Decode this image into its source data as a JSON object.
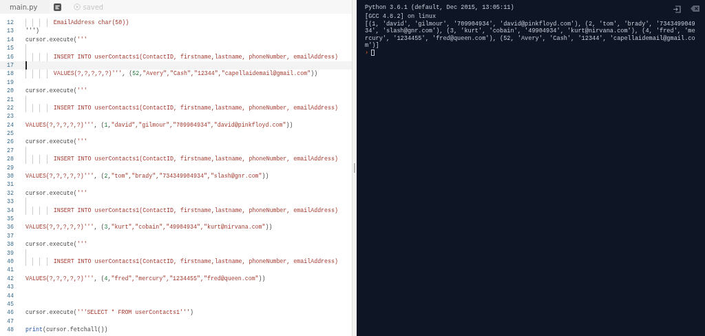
{
  "tabs": [
    {
      "label": "main.py",
      "selected": true
    }
  ],
  "save_status": {
    "label": "saved"
  },
  "editor": {
    "lines": [
      {
        "number": "12",
        "kind": "indented",
        "current": false,
        "segments": [
          {
            "text": "EmailAddress char(50))",
            "kind": "string"
          }
        ]
      },
      {
        "number": "13",
        "kind": "code",
        "current": false,
        "segments": [
          {
            "text": "''')",
            "kind": "plain"
          }
        ]
      },
      {
        "number": "14",
        "kind": "code",
        "current": false,
        "segments": [
          {
            "text": "cursor.execute(",
            "kind": "plain"
          },
          {
            "text": "'''",
            "kind": "string"
          }
        ]
      },
      {
        "number": "15",
        "kind": "guide",
        "current": false
      },
      {
        "number": "16",
        "kind": "indented",
        "current": false,
        "segments": [
          {
            "text": "INSERT INTO userContacts1(ContactID, firstname,lastname, phoneNumber, emailAddress)",
            "kind": "string"
          }
        ]
      },
      {
        "number": "17",
        "kind": "blank",
        "current": true
      },
      {
        "number": "18",
        "kind": "indented",
        "current": false,
        "segments": [
          {
            "text": "VALUES(?,?,?,?,?)'''",
            "kind": "string"
          },
          {
            "text": ", (",
            "kind": "plain"
          },
          {
            "text": "52",
            "kind": "number"
          },
          {
            "text": ",",
            "kind": "plain"
          },
          {
            "text": "\"Avery\",\"Cash\",\"12344\",\"capellaidemail@gmail.com\"",
            "kind": "string"
          },
          {
            "text": "))",
            "kind": "plain"
          }
        ]
      },
      {
        "number": "19",
        "kind": "blank",
        "current": false
      },
      {
        "number": "20",
        "kind": "code",
        "current": false,
        "segments": [
          {
            "text": "cursor.execute(",
            "kind": "plain"
          },
          {
            "text": "'''",
            "kind": "string"
          }
        ]
      },
      {
        "number": "21",
        "kind": "guide",
        "current": false
      },
      {
        "number": "22",
        "kind": "indented",
        "current": false,
        "segments": [
          {
            "text": "INSERT INTO userContacts1(ContactID, firstname,lastname, phoneNumber, emailAddress)",
            "kind": "string"
          }
        ]
      },
      {
        "number": "23",
        "kind": "blank",
        "current": false
      },
      {
        "number": "24",
        "kind": "code",
        "current": false,
        "segments": [
          {
            "text": "VALUES(?,?,?,?,?)'''",
            "kind": "string"
          },
          {
            "text": ", (",
            "kind": "plain"
          },
          {
            "text": "1",
            "kind": "number"
          },
          {
            "text": ",",
            "kind": "plain"
          },
          {
            "text": "\"david\",\"gilmour\",\"709904934\",\"david@pinkfloyd.com\"",
            "kind": "string"
          },
          {
            "text": "))",
            "kind": "plain"
          }
        ]
      },
      {
        "number": "25",
        "kind": "blank",
        "current": false
      },
      {
        "number": "26",
        "kind": "code",
        "current": false,
        "segments": [
          {
            "text": "cursor.execute(",
            "kind": "plain"
          },
          {
            "text": "'''",
            "kind": "string"
          }
        ]
      },
      {
        "number": "27",
        "kind": "guide",
        "current": false
      },
      {
        "number": "28",
        "kind": "indented",
        "current": false,
        "segments": [
          {
            "text": "INSERT INTO userContacts1(ContactID, firstname,lastname, phoneNumber, emailAddress)",
            "kind": "string"
          }
        ]
      },
      {
        "number": "29",
        "kind": "blank",
        "current": false
      },
      {
        "number": "30",
        "kind": "code",
        "current": false,
        "segments": [
          {
            "text": "VALUES(?,?,?,?,?)'''",
            "kind": "string"
          },
          {
            "text": ", (",
            "kind": "plain"
          },
          {
            "text": "2",
            "kind": "number"
          },
          {
            "text": ",",
            "kind": "plain"
          },
          {
            "text": "\"tom\",\"brady\",\"734349904934\",\"slash@gnr.com\"",
            "kind": "string"
          },
          {
            "text": "))",
            "kind": "plain"
          }
        ]
      },
      {
        "number": "31",
        "kind": "blank",
        "current": false
      },
      {
        "number": "32",
        "kind": "code",
        "current": false,
        "segments": [
          {
            "text": "cursor.execute(",
            "kind": "plain"
          },
          {
            "text": "'''",
            "kind": "string"
          }
        ]
      },
      {
        "number": "33",
        "kind": "guide",
        "current": false
      },
      {
        "number": "34",
        "kind": "indented",
        "current": false,
        "segments": [
          {
            "text": "INSERT INTO userContacts1(ContactID, firstname,lastname, phoneNumber, emailAddress)",
            "kind": "string"
          }
        ]
      },
      {
        "number": "35",
        "kind": "blank",
        "current": false
      },
      {
        "number": "36",
        "kind": "code",
        "current": false,
        "segments": [
          {
            "text": "VALUES(?,?,?,?,?)'''",
            "kind": "string"
          },
          {
            "text": ", (",
            "kind": "plain"
          },
          {
            "text": "3",
            "kind": "number"
          },
          {
            "text": ",",
            "kind": "plain"
          },
          {
            "text": "\"kurt\",\"cobain\",\"49904934\",\"kurt@nirvana.com\"",
            "kind": "string"
          },
          {
            "text": "))",
            "kind": "plain"
          }
        ]
      },
      {
        "number": "37",
        "kind": "blank",
        "current": false
      },
      {
        "number": "38",
        "kind": "code",
        "current": false,
        "segments": [
          {
            "text": "cursor.execute(",
            "kind": "plain"
          },
          {
            "text": "'''",
            "kind": "string"
          }
        ]
      },
      {
        "number": "39",
        "kind": "guide",
        "current": false
      },
      {
        "number": "40",
        "kind": "indented",
        "current": false,
        "segments": [
          {
            "text": "INSERT INTO userContacts1(ContactID, firstname,lastname, phoneNumber, emailAddress)",
            "kind": "string"
          }
        ]
      },
      {
        "number": "41",
        "kind": "blank",
        "current": false
      },
      {
        "number": "42",
        "kind": "code",
        "current": false,
        "segments": [
          {
            "text": "VALUES(?,?,?,?,?)'''",
            "kind": "string"
          },
          {
            "text": ", (",
            "kind": "plain"
          },
          {
            "text": "4",
            "kind": "number"
          },
          {
            "text": ",",
            "kind": "plain"
          },
          {
            "text": "\"fred\",\"mercury\",\"1234455\",\"fred@queen.com\"",
            "kind": "string"
          },
          {
            "text": "))",
            "kind": "plain"
          }
        ]
      },
      {
        "number": "43",
        "kind": "blank",
        "current": false
      },
      {
        "number": "44",
        "kind": "blank",
        "current": false
      },
      {
        "number": "45",
        "kind": "blank",
        "current": false
      },
      {
        "number": "46",
        "kind": "code",
        "current": false,
        "segments": [
          {
            "text": "cursor.execute(",
            "kind": "plain"
          },
          {
            "text": "'''SELECT * FROM userContacts1'''",
            "kind": "string"
          },
          {
            "text": ")",
            "kind": "plain"
          }
        ]
      },
      {
        "number": "47",
        "kind": "blank",
        "current": false
      },
      {
        "number": "48",
        "kind": "code",
        "current": false,
        "segments": [
          {
            "text": "print",
            "kind": "builtin"
          },
          {
            "text": "(cursor.fetchall())",
            "kind": "plain"
          }
        ]
      }
    ]
  },
  "console": {
    "lines": [
      "Python 3.6.1 (default, Dec 2015, 13:05:11)",
      "[GCC 4.8.2] on linux",
      "[(1, 'david', 'gilmour', '709904934', 'david@pinkfloyd.com'), (2, 'tom', 'brady', '7343499049",
      "34', 'slash@gnr.com'), (3, 'kurt', 'cobain', '49904934', 'kurt@nirvana.com'), (4, 'fred', 'me",
      "rcury', '1234455', 'fred@queen.com'), (52, 'Avery', 'Cash', '12344', 'capellaidemail@gmail.co",
      "m')]"
    ],
    "prompt": "›"
  }
}
